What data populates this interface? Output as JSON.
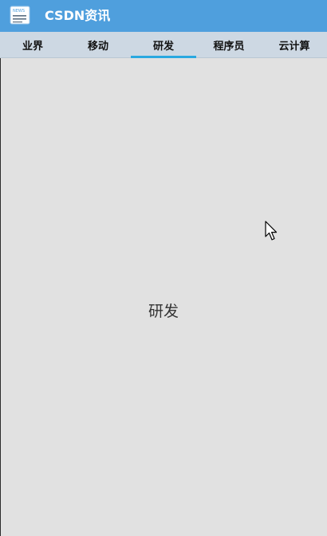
{
  "app_bar": {
    "title": "CSDN资讯",
    "icon": "news-icon",
    "icon_text": "NEWS",
    "color": "#4f9fdd"
  },
  "tabs": [
    {
      "label": "业界",
      "selected": false
    },
    {
      "label": "移动",
      "selected": false
    },
    {
      "label": "研发",
      "selected": true
    },
    {
      "label": "程序员",
      "selected": false
    },
    {
      "label": "云计算",
      "selected": false
    }
  ],
  "tab_indicator_color": "#29a8e0",
  "content": {
    "text": "研发"
  },
  "cursor": {
    "icon": "mouse-pointer-icon"
  }
}
